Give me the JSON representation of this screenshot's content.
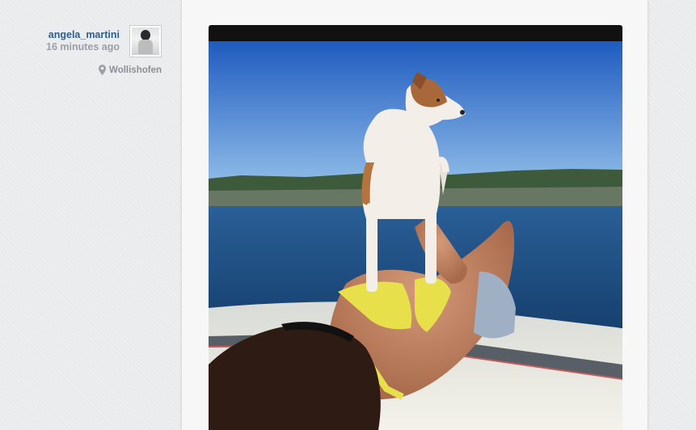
{
  "post": {
    "username": "angela_martini",
    "timestamp": "16 minutes ago",
    "location": "Wollishofen",
    "avatar_icon": "user-avatar",
    "location_icon": "map-pin-icon",
    "photo_alt": "photo"
  },
  "colors": {
    "username": "#2f5e8c",
    "muted": "#9aa0a6",
    "sky_top": "#1f5bbf",
    "sky_bottom": "#8ab8e6",
    "lake": "#1e4f86",
    "bikini": "#e8e04a"
  }
}
